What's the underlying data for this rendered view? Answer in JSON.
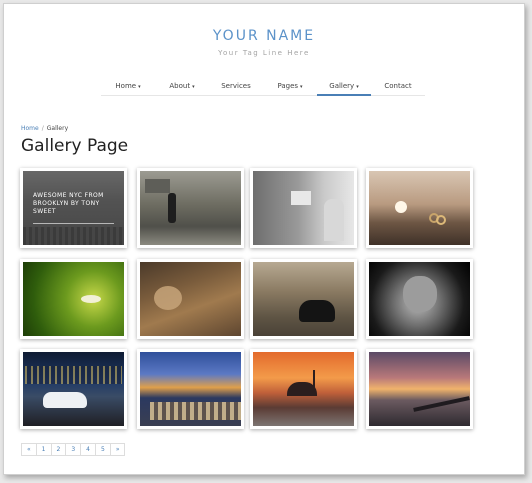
{
  "brand": {
    "name": "YOUR NAME",
    "tagline": "Your Tag Line Here"
  },
  "nav": {
    "items": [
      {
        "label": "Home",
        "caret": "▾"
      },
      {
        "label": "About",
        "caret": "▾"
      },
      {
        "label": "Services",
        "caret": ""
      },
      {
        "label": "Pages",
        "caret": "▾"
      },
      {
        "label": "Gallery",
        "caret": "▾"
      },
      {
        "label": "Contact",
        "caret": ""
      }
    ]
  },
  "breadcrumb": {
    "home": "Home",
    "separator": "/",
    "current": "Gallery"
  },
  "page": {
    "title": "Gallery Page"
  },
  "gallery": {
    "overlay_caption": "AWESOME NYC FROM BROOKLYN BY TONY SWEET"
  },
  "pagination": {
    "items": [
      "«",
      "1",
      "2",
      "3",
      "4",
      "5",
      "»"
    ]
  },
  "colors": {
    "accent": "#4a7fb6",
    "brand": "#5b92c9"
  }
}
